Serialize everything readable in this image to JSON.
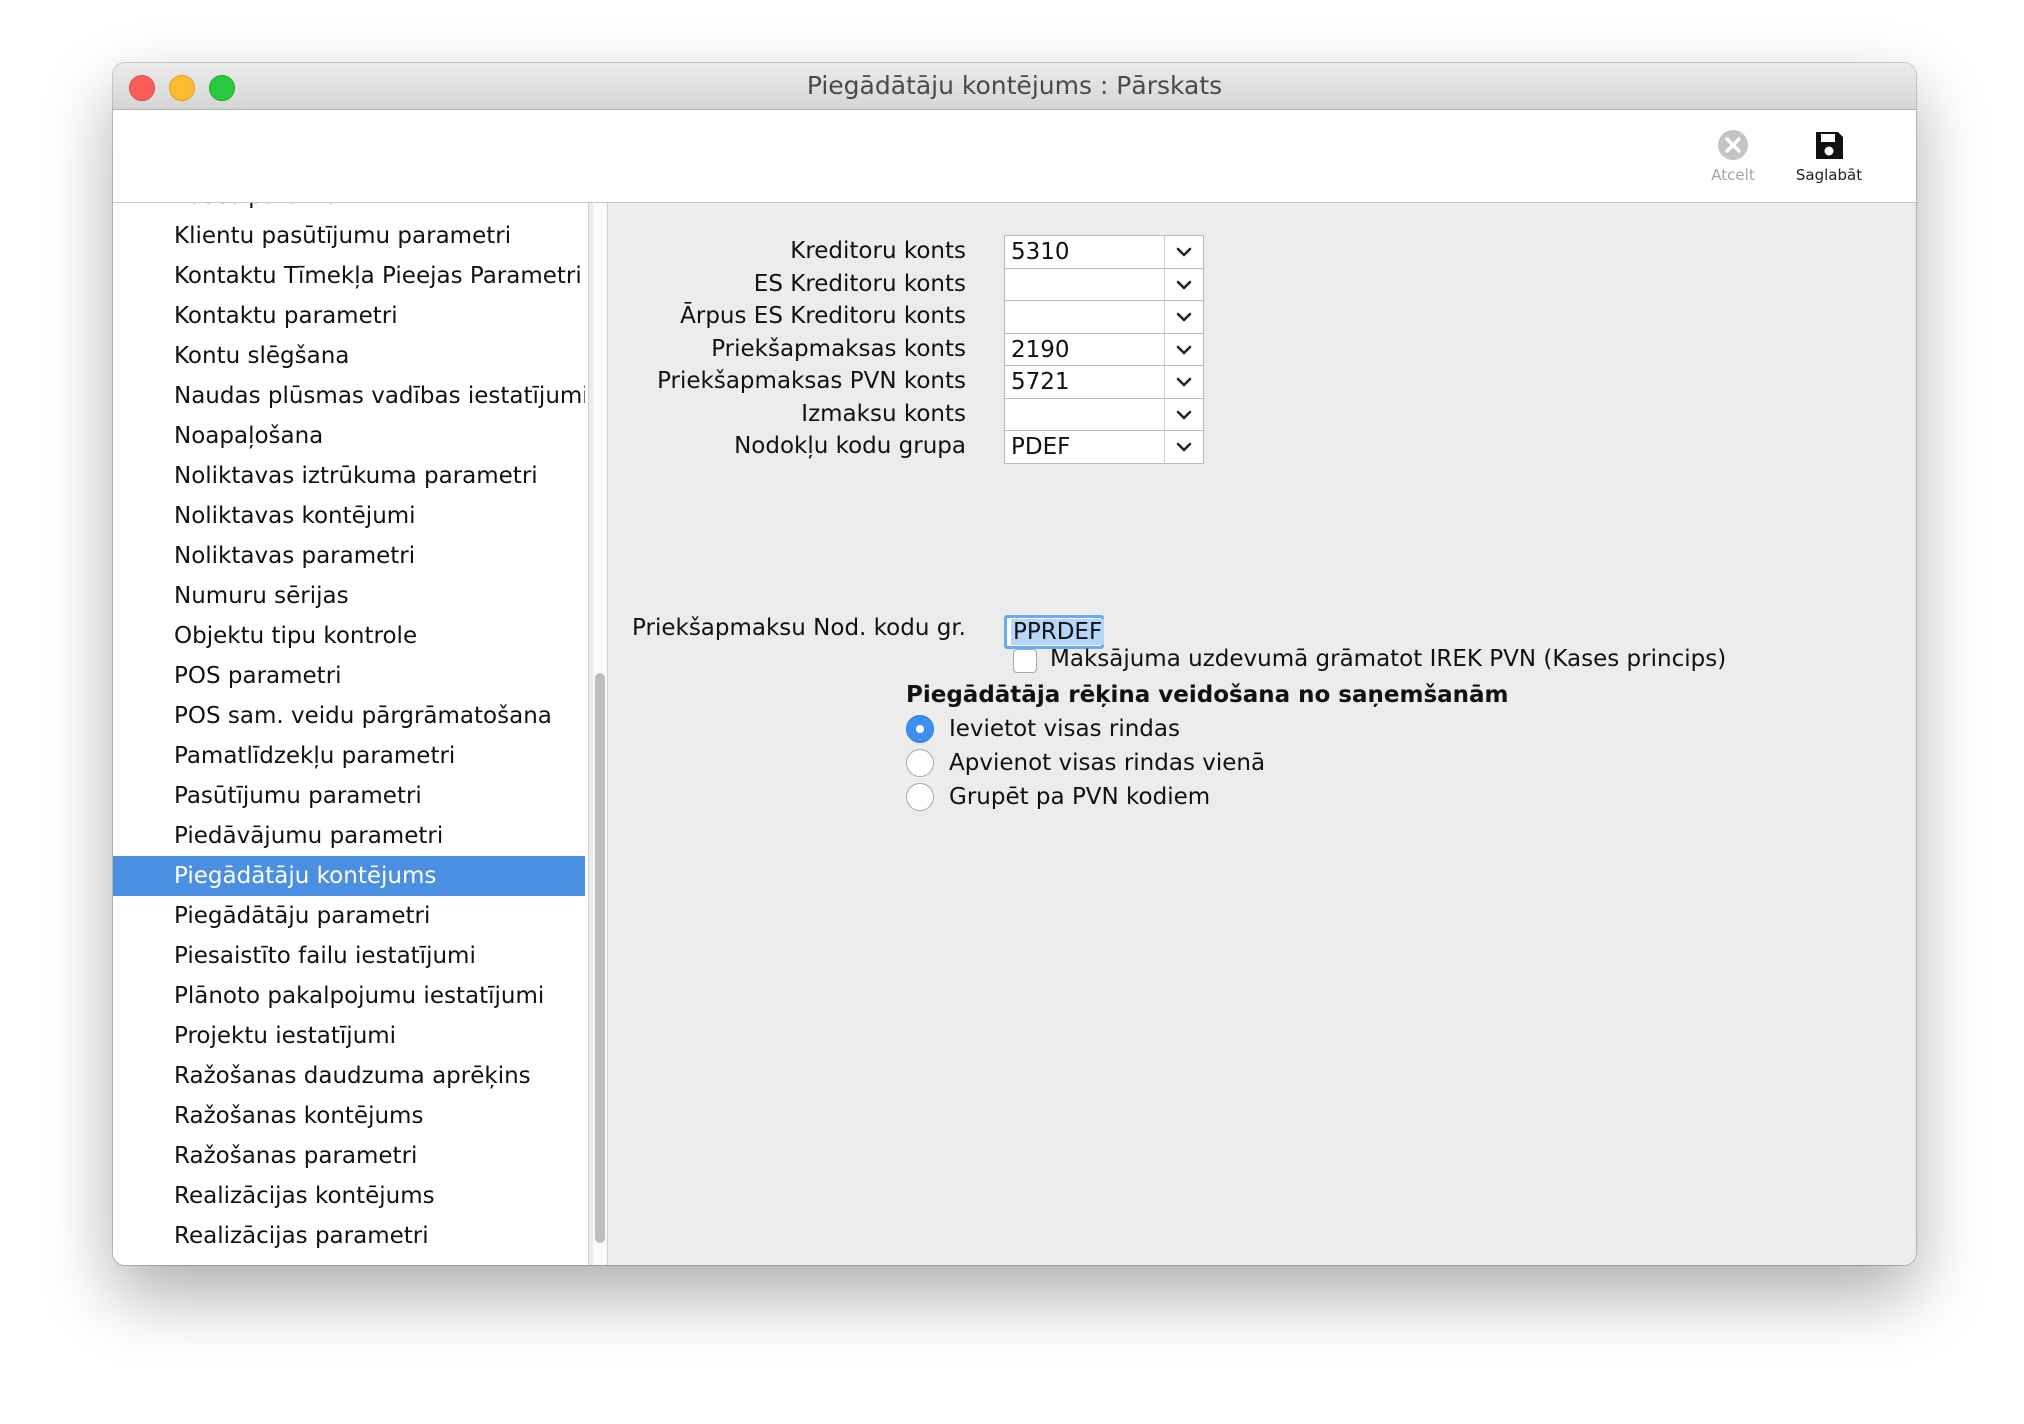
{
  "window": {
    "title": "Piegādātāju kontējums : Pārskats"
  },
  "toolbar": {
    "cancel_label": "Atcelt",
    "save_label": "Saglabāt"
  },
  "sidebar": {
    "items": [
      "Kases parametri",
      "Klientu pasūtījumu parametri",
      "Kontaktu Tīmekļa Pieejas Parametri",
      "Kontaktu parametri",
      "Kontu slēgšana",
      "Naudas plūsmas vadības iestatījumi",
      "Noapaļošana",
      "Noliktavas iztrūkuma parametri",
      "Noliktavas kontējumi",
      "Noliktavas parametri",
      "Numuru sērijas",
      "Objektu tipu kontrole",
      "POS parametri",
      "POS sam. veidu pārgrāmatošana",
      "Pamatlīdzekļu parametri",
      "Pasūtījumu parametri",
      "Piedāvājumu parametri",
      "Piegādātāju kontējums",
      "Piegādātāju parametri",
      "Piesaistīto failu iestatījumi",
      "Plānoto pakalpojumu iestatījumi",
      "Projektu iestatījumi",
      "Ražošanas daudzuma aprēķins",
      "Ražošanas kontējums",
      "Ražošanas parametri",
      "Realizācijas kontējums",
      "Realizācijas parametri"
    ],
    "selected_index": 17
  },
  "form": {
    "fields": [
      {
        "label": "Kreditoru konts",
        "value": "5310"
      },
      {
        "label": "ES Kreditoru konts",
        "value": ""
      },
      {
        "label": "Ārpus ES Kreditoru konts",
        "value": ""
      },
      {
        "label": "Priekšapmaksas konts",
        "value": "2190"
      },
      {
        "label": "Priekšapmaksas PVN konts",
        "value": "5721"
      },
      {
        "label": "Izmaksu konts",
        "value": ""
      },
      {
        "label": "Nodokļu kodu grupa",
        "value": "PDEF"
      }
    ],
    "prepay_tax_group": {
      "label": "Priekšapmaksu Nod. kodu gr.",
      "value": "PPRDEF"
    },
    "checkbox": {
      "label": "Maksājuma uzdevumā grāmatot IREK PVN (Kases princips)",
      "checked": false
    },
    "radio_group": {
      "title": "Piegādātāja rēķina veidošana no saņemšanām",
      "options": [
        {
          "label": "Ievietot visas rindas",
          "selected": true
        },
        {
          "label": "Apvienot visas rindas vienā",
          "selected": false
        },
        {
          "label": "Grupēt pa PVN kodiem",
          "selected": false
        }
      ]
    }
  },
  "colors": {
    "selection": "#4a8fe2",
    "radio_on": "#3d8ef0",
    "focus_ring": "#6aa9f3"
  }
}
